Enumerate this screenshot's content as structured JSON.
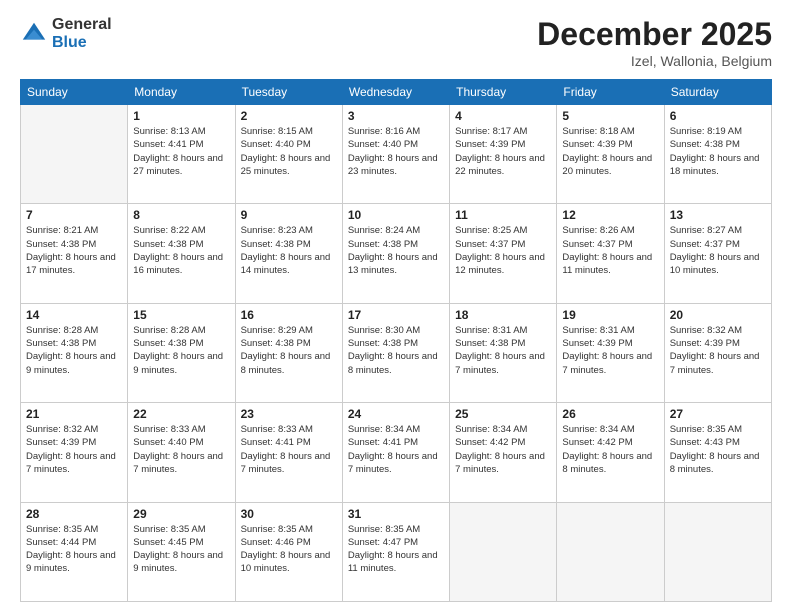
{
  "header": {
    "logo_general": "General",
    "logo_blue": "Blue",
    "month_title": "December 2025",
    "location": "Izel, Wallonia, Belgium"
  },
  "days_of_week": [
    "Sunday",
    "Monday",
    "Tuesday",
    "Wednesday",
    "Thursday",
    "Friday",
    "Saturday"
  ],
  "weeks": [
    [
      {
        "num": "",
        "info": ""
      },
      {
        "num": "1",
        "info": "Sunrise: 8:13 AM\nSunset: 4:41 PM\nDaylight: 8 hours\nand 27 minutes."
      },
      {
        "num": "2",
        "info": "Sunrise: 8:15 AM\nSunset: 4:40 PM\nDaylight: 8 hours\nand 25 minutes."
      },
      {
        "num": "3",
        "info": "Sunrise: 8:16 AM\nSunset: 4:40 PM\nDaylight: 8 hours\nand 23 minutes."
      },
      {
        "num": "4",
        "info": "Sunrise: 8:17 AM\nSunset: 4:39 PM\nDaylight: 8 hours\nand 22 minutes."
      },
      {
        "num": "5",
        "info": "Sunrise: 8:18 AM\nSunset: 4:39 PM\nDaylight: 8 hours\nand 20 minutes."
      },
      {
        "num": "6",
        "info": "Sunrise: 8:19 AM\nSunset: 4:38 PM\nDaylight: 8 hours\nand 18 minutes."
      }
    ],
    [
      {
        "num": "7",
        "info": "Sunrise: 8:21 AM\nSunset: 4:38 PM\nDaylight: 8 hours\nand 17 minutes."
      },
      {
        "num": "8",
        "info": "Sunrise: 8:22 AM\nSunset: 4:38 PM\nDaylight: 8 hours\nand 16 minutes."
      },
      {
        "num": "9",
        "info": "Sunrise: 8:23 AM\nSunset: 4:38 PM\nDaylight: 8 hours\nand 14 minutes."
      },
      {
        "num": "10",
        "info": "Sunrise: 8:24 AM\nSunset: 4:38 PM\nDaylight: 8 hours\nand 13 minutes."
      },
      {
        "num": "11",
        "info": "Sunrise: 8:25 AM\nSunset: 4:37 PM\nDaylight: 8 hours\nand 12 minutes."
      },
      {
        "num": "12",
        "info": "Sunrise: 8:26 AM\nSunset: 4:37 PM\nDaylight: 8 hours\nand 11 minutes."
      },
      {
        "num": "13",
        "info": "Sunrise: 8:27 AM\nSunset: 4:37 PM\nDaylight: 8 hours\nand 10 minutes."
      }
    ],
    [
      {
        "num": "14",
        "info": "Sunrise: 8:28 AM\nSunset: 4:38 PM\nDaylight: 8 hours\nand 9 minutes."
      },
      {
        "num": "15",
        "info": "Sunrise: 8:28 AM\nSunset: 4:38 PM\nDaylight: 8 hours\nand 9 minutes."
      },
      {
        "num": "16",
        "info": "Sunrise: 8:29 AM\nSunset: 4:38 PM\nDaylight: 8 hours\nand 8 minutes."
      },
      {
        "num": "17",
        "info": "Sunrise: 8:30 AM\nSunset: 4:38 PM\nDaylight: 8 hours\nand 8 minutes."
      },
      {
        "num": "18",
        "info": "Sunrise: 8:31 AM\nSunset: 4:38 PM\nDaylight: 8 hours\nand 7 minutes."
      },
      {
        "num": "19",
        "info": "Sunrise: 8:31 AM\nSunset: 4:39 PM\nDaylight: 8 hours\nand 7 minutes."
      },
      {
        "num": "20",
        "info": "Sunrise: 8:32 AM\nSunset: 4:39 PM\nDaylight: 8 hours\nand 7 minutes."
      }
    ],
    [
      {
        "num": "21",
        "info": "Sunrise: 8:32 AM\nSunset: 4:39 PM\nDaylight: 8 hours\nand 7 minutes."
      },
      {
        "num": "22",
        "info": "Sunrise: 8:33 AM\nSunset: 4:40 PM\nDaylight: 8 hours\nand 7 minutes."
      },
      {
        "num": "23",
        "info": "Sunrise: 8:33 AM\nSunset: 4:41 PM\nDaylight: 8 hours\nand 7 minutes."
      },
      {
        "num": "24",
        "info": "Sunrise: 8:34 AM\nSunset: 4:41 PM\nDaylight: 8 hours\nand 7 minutes."
      },
      {
        "num": "25",
        "info": "Sunrise: 8:34 AM\nSunset: 4:42 PM\nDaylight: 8 hours\nand 7 minutes."
      },
      {
        "num": "26",
        "info": "Sunrise: 8:34 AM\nSunset: 4:42 PM\nDaylight: 8 hours\nand 8 minutes."
      },
      {
        "num": "27",
        "info": "Sunrise: 8:35 AM\nSunset: 4:43 PM\nDaylight: 8 hours\nand 8 minutes."
      }
    ],
    [
      {
        "num": "28",
        "info": "Sunrise: 8:35 AM\nSunset: 4:44 PM\nDaylight: 8 hours\nand 9 minutes."
      },
      {
        "num": "29",
        "info": "Sunrise: 8:35 AM\nSunset: 4:45 PM\nDaylight: 8 hours\nand 9 minutes."
      },
      {
        "num": "30",
        "info": "Sunrise: 8:35 AM\nSunset: 4:46 PM\nDaylight: 8 hours\nand 10 minutes."
      },
      {
        "num": "31",
        "info": "Sunrise: 8:35 AM\nSunset: 4:47 PM\nDaylight: 8 hours\nand 11 minutes."
      },
      {
        "num": "",
        "info": ""
      },
      {
        "num": "",
        "info": ""
      },
      {
        "num": "",
        "info": ""
      }
    ]
  ]
}
